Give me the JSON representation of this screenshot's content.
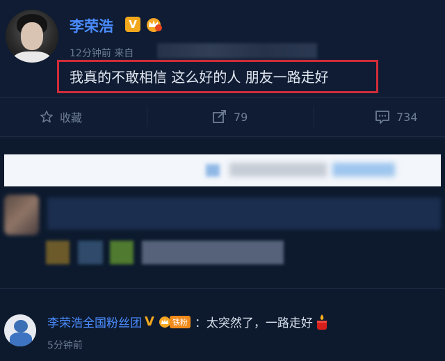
{
  "post": {
    "author": "李荣浩",
    "verified_badge": "V",
    "time": "12分钟前",
    "source_label": "来自",
    "content": "我真的不敢相信 这么好的人 朋友一路走好",
    "highlight_color": "#d02c3a"
  },
  "actions": {
    "favorite_label": "收藏",
    "repost_count": "79",
    "comment_count": "734"
  },
  "comments": [
    {
      "author": "李荣浩全国粉丝团",
      "verified_badge": "V",
      "fan_badge": "铁粉",
      "text": "：太突然了，一路走好",
      "time": "5分钟前"
    }
  ],
  "colors": {
    "background": "#0d1a2e",
    "name_link": "#4a8cff",
    "verified": "#f2a81d"
  }
}
